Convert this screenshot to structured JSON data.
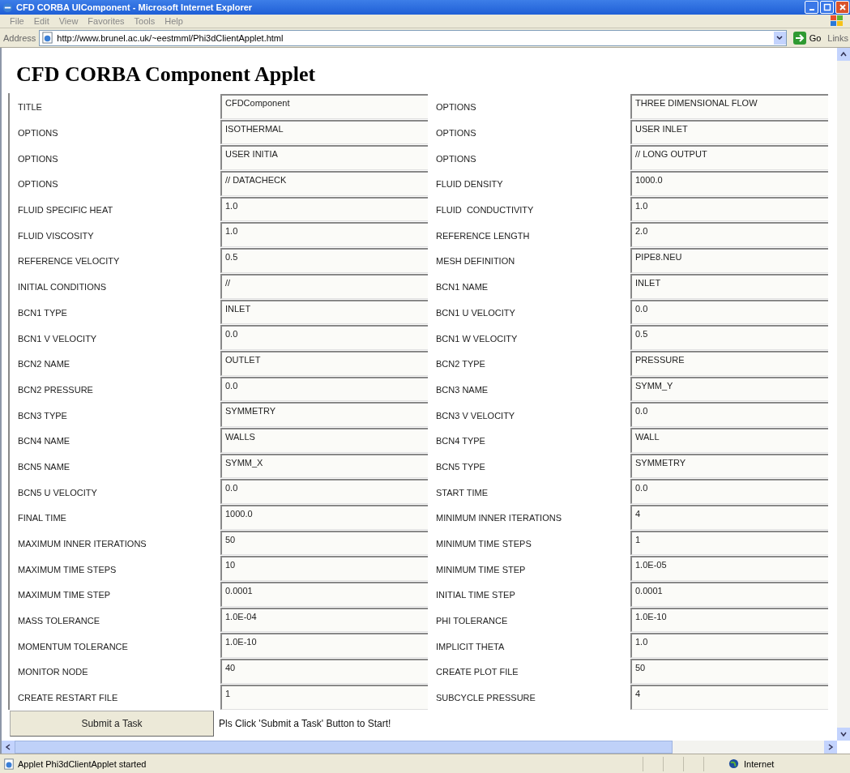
{
  "window": {
    "title": "CFD CORBA UIComponent - Microsoft Internet Explorer"
  },
  "menu": [
    "File",
    "Edit",
    "View",
    "Favorites",
    "Tools",
    "Help"
  ],
  "address_bar": {
    "label": "Address",
    "url": "http://www.brunel.ac.uk/~eestmml/Phi3dClientApplet.html",
    "go": "Go",
    "links": "Links"
  },
  "heading": "CFD CORBA Component Applet",
  "rows": [
    [
      {
        "label": "TITLE",
        "value": "CFDComponent"
      },
      {
        "label": "OPTIONS",
        "value": "THREE DIMENSIONAL FLOW"
      }
    ],
    [
      {
        "label": "OPTIONS",
        "value": "ISOTHERMAL"
      },
      {
        "label": "OPTIONS",
        "value": "USER INLET"
      }
    ],
    [
      {
        "label": "OPTIONS",
        "value": "USER INITIA"
      },
      {
        "label": "OPTIONS",
        "value": "// LONG OUTPUT"
      }
    ],
    [
      {
        "label": "OPTIONS",
        "value": "// DATACHECK"
      },
      {
        "label": "FLUID DENSITY",
        "value": "1000.0"
      }
    ],
    [
      {
        "label": "FLUID SPECIFIC HEAT",
        "value": "1.0"
      },
      {
        "label": "FLUID  CONDUCTIVITY",
        "value": "1.0"
      }
    ],
    [
      {
        "label": "FLUID VISCOSITY",
        "value": "1.0"
      },
      {
        "label": "REFERENCE LENGTH",
        "value": "2.0"
      }
    ],
    [
      {
        "label": "REFERENCE VELOCITY",
        "value": "0.5"
      },
      {
        "label": "MESH DEFINITION",
        "value": "PIPE8.NEU"
      }
    ],
    [
      {
        "label": "INITIAL CONDITIONS",
        "value": "//"
      },
      {
        "label": "BCN1 NAME",
        "value": "INLET"
      }
    ],
    [
      {
        "label": "BCN1 TYPE",
        "value": "INLET"
      },
      {
        "label": "BCN1 U VELOCITY",
        "value": "0.0"
      }
    ],
    [
      {
        "label": "BCN1 V VELOCITY",
        "value": "0.0"
      },
      {
        "label": "BCN1 W VELOCITY",
        "value": "0.5"
      }
    ],
    [
      {
        "label": "BCN2 NAME",
        "value": "OUTLET"
      },
      {
        "label": "BCN2 TYPE",
        "value": "PRESSURE"
      }
    ],
    [
      {
        "label": "BCN2 PRESSURE",
        "value": "0.0"
      },
      {
        "label": "BCN3 NAME",
        "value": "SYMM_Y"
      }
    ],
    [
      {
        "label": "BCN3 TYPE",
        "value": "SYMMETRY"
      },
      {
        "label": "BCN3 V VELOCITY",
        "value": "0.0"
      }
    ],
    [
      {
        "label": "BCN4 NAME",
        "value": "WALLS"
      },
      {
        "label": "BCN4 TYPE",
        "value": "WALL"
      }
    ],
    [
      {
        "label": "BCN5 NAME",
        "value": "SYMM_X"
      },
      {
        "label": "BCN5 TYPE",
        "value": "SYMMETRY"
      }
    ],
    [
      {
        "label": "BCN5 U VELOCITY",
        "value": "0.0"
      },
      {
        "label": "START TIME",
        "value": "0.0"
      }
    ],
    [
      {
        "label": "FINAL TIME",
        "value": "1000.0"
      },
      {
        "label": "MINIMUM INNER ITERATIONS",
        "value": "4"
      }
    ],
    [
      {
        "label": "MAXIMUM INNER ITERATIONS",
        "value": "50"
      },
      {
        "label": "MINIMUM TIME STEPS",
        "value": "1"
      }
    ],
    [
      {
        "label": "MAXIMUM TIME STEPS",
        "value": "10"
      },
      {
        "label": "MINIMUM TIME STEP",
        "value": "1.0E-05"
      }
    ],
    [
      {
        "label": "MAXIMUM TIME STEP",
        "value": "0.0001"
      },
      {
        "label": "INITIAL TIME STEP",
        "value": "0.0001"
      }
    ],
    [
      {
        "label": "MASS TOLERANCE",
        "value": "1.0E-04"
      },
      {
        "label": "PHI TOLERANCE",
        "value": "1.0E-10"
      }
    ],
    [
      {
        "label": "MOMENTUM TOLERANCE",
        "value": "1.0E-10"
      },
      {
        "label": "IMPLICIT THETA",
        "value": "1.0"
      }
    ],
    [
      {
        "label": "MONITOR NODE",
        "value": "40"
      },
      {
        "label": "CREATE PLOT FILE",
        "value": "50"
      }
    ],
    [
      {
        "label": "CREATE RESTART FILE",
        "value": "1"
      },
      {
        "label": "SUBCYCLE PRESSURE",
        "value": "4"
      }
    ]
  ],
  "submit_button": "Submit a Task",
  "message": "Pls Click 'Submit a Task' Button to Start!",
  "status_bar": {
    "text": "Applet Phi3dClientApplet started",
    "zone": "Internet"
  }
}
